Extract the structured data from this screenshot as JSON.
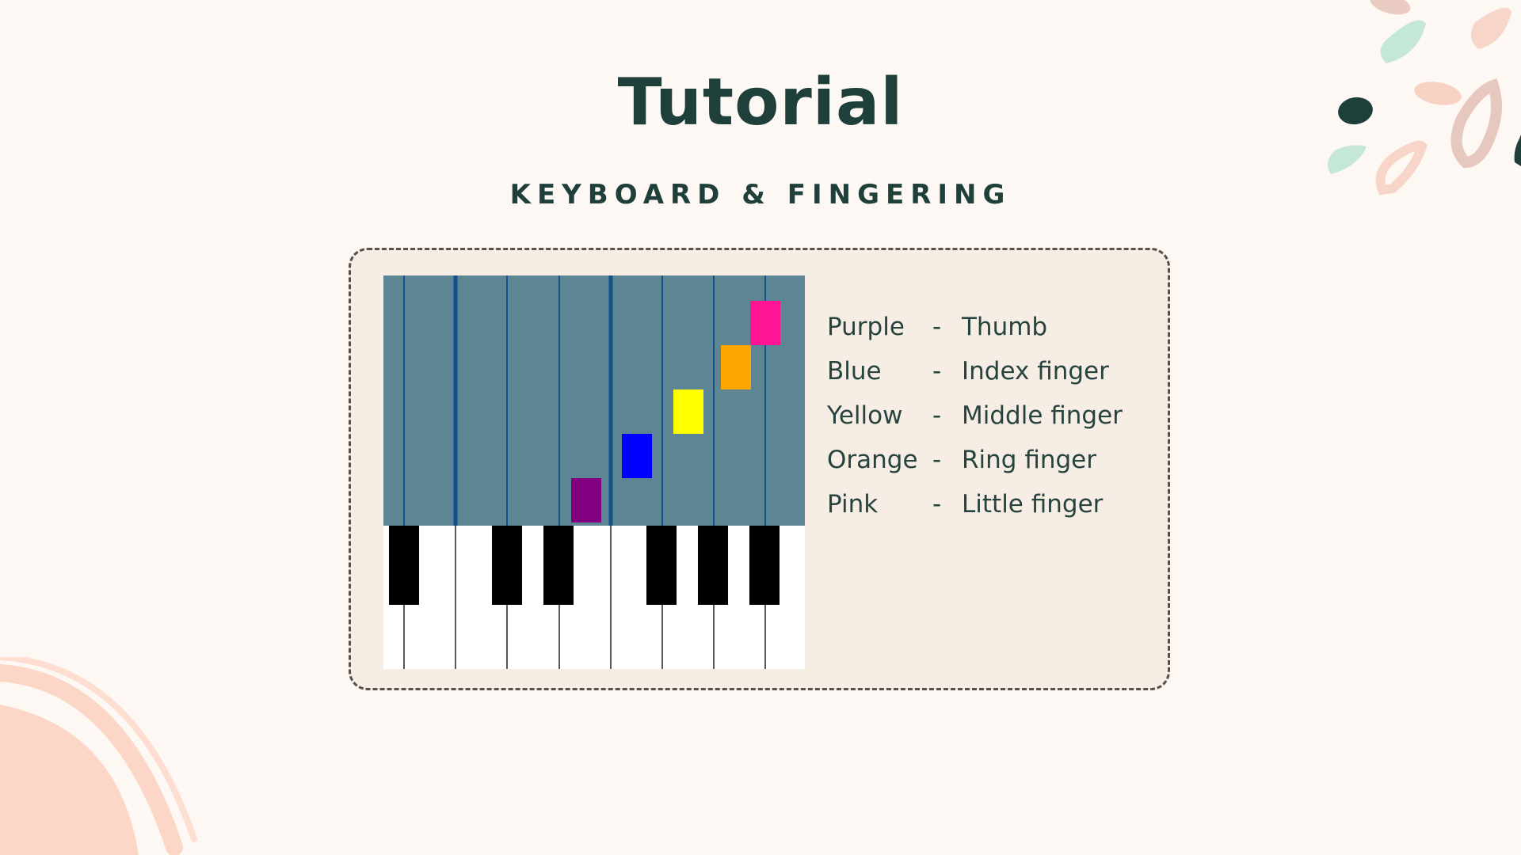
{
  "slide": {
    "title": "Tutorial",
    "subtitle": "KEYBOARD & FINGERING"
  },
  "legend": [
    {
      "color_name": "Purple",
      "dash": "-",
      "finger": "Thumb",
      "swatch": "#800080"
    },
    {
      "color_name": "Blue",
      "dash": "-",
      "finger": "Index finger",
      "swatch": "#0000ff"
    },
    {
      "color_name": "Yellow",
      "dash": "-",
      "finger": "Middle finger",
      "swatch": "#ffff00"
    },
    {
      "color_name": "Orange",
      "dash": "-",
      "finger": "Ring finger",
      "swatch": "#ffa500"
    },
    {
      "color_name": "Pink",
      "dash": "-",
      "finger": "Little finger",
      "swatch": "#ff1493"
    }
  ],
  "colors": {
    "background": "#fdf8f4",
    "card_background": "#f6ede5",
    "card_border": "#5a504b",
    "heading_text": "#1f3f3b",
    "note_lane_background": "#5d8594",
    "lane_line": "#14508a",
    "white_key": "#ffffff",
    "black_key": "#000000"
  },
  "piano": {
    "white_key_count": 8,
    "black_key_count": 6,
    "falling_notes": [
      "Purple",
      "Blue",
      "Yellow",
      "Orange",
      "Pink"
    ]
  },
  "decorations": {
    "top_right": "leaf-petal-cluster",
    "bottom_left": "peach-arc"
  }
}
